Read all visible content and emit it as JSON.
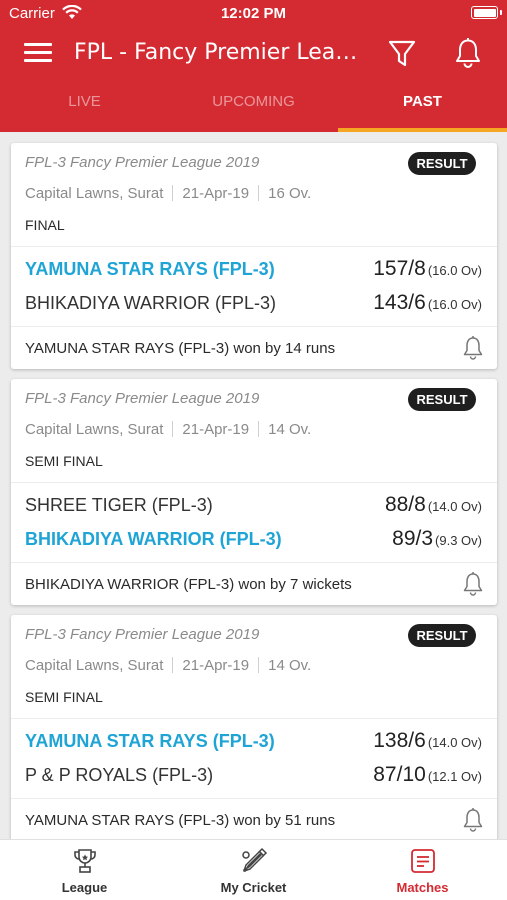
{
  "status_bar": {
    "carrier": "Carrier",
    "time": "12:02 PM"
  },
  "app_bar": {
    "title": "FPL - Fancy Premier League",
    "menu_icon": "hamburger-menu-icon",
    "filter_icon": "filter-funnel-icon",
    "notification_icon": "bell-icon"
  },
  "tabs": [
    {
      "label": "LIVE",
      "active": false
    },
    {
      "label": "UPCOMING",
      "active": false
    },
    {
      "label": "PAST",
      "active": true
    }
  ],
  "colors": {
    "primary": "#d42b33",
    "tab_indicator": "#f5a623",
    "winner_text": "#1fa4d6",
    "badge_bg": "#1f1f1f"
  },
  "matches": [
    {
      "league": "FPL-3 Fancy Premier League 2019",
      "badge": "RESULT",
      "venue": "Capital Lawns, Surat",
      "date": "21-Apr-19",
      "overs": "16 Ov.",
      "round": "FINAL",
      "teams": [
        {
          "name": "YAMUNA STAR RAYS (FPL-3)",
          "score": "157/8",
          "overs": "(16.0 Ov)",
          "winner": true
        },
        {
          "name": "BHIKADIYA WARRIOR (FPL-3)",
          "score": "143/6",
          "overs": "(16.0 Ov)",
          "winner": false
        }
      ],
      "result": "YAMUNA STAR RAYS (FPL-3) won by 14 runs"
    },
    {
      "league": "FPL-3 Fancy Premier League 2019",
      "badge": "RESULT",
      "venue": "Capital Lawns, Surat",
      "date": "21-Apr-19",
      "overs": "14 Ov.",
      "round": "SEMI FINAL",
      "teams": [
        {
          "name": "SHREE TIGER (FPL-3)",
          "score": "88/8",
          "overs": "(14.0 Ov)",
          "winner": false
        },
        {
          "name": "BHIKADIYA WARRIOR (FPL-3)",
          "score": "89/3",
          "overs": "(9.3 Ov)",
          "winner": true
        }
      ],
      "result": "BHIKADIYA WARRIOR (FPL-3) won by 7 wickets"
    },
    {
      "league": "FPL-3 Fancy Premier League 2019",
      "badge": "RESULT",
      "venue": "Capital Lawns, Surat",
      "date": "21-Apr-19",
      "overs": "14 Ov.",
      "round": "SEMI FINAL",
      "teams": [
        {
          "name": "YAMUNA STAR RAYS (FPL-3)",
          "score": "138/6",
          "overs": "(14.0 Ov)",
          "winner": true
        },
        {
          "name": "P & P ROYALS (FPL-3)",
          "score": "87/10",
          "overs": "(12.1 Ov)",
          "winner": false
        }
      ],
      "result": "YAMUNA STAR RAYS (FPL-3) won by 51 runs"
    }
  ],
  "bottom_nav": [
    {
      "label": "League",
      "icon": "trophy-icon",
      "active": false
    },
    {
      "label": "My Cricket",
      "icon": "cricket-bat-icon",
      "active": false
    },
    {
      "label": "Matches",
      "icon": "matches-list-icon",
      "active": true
    }
  ]
}
